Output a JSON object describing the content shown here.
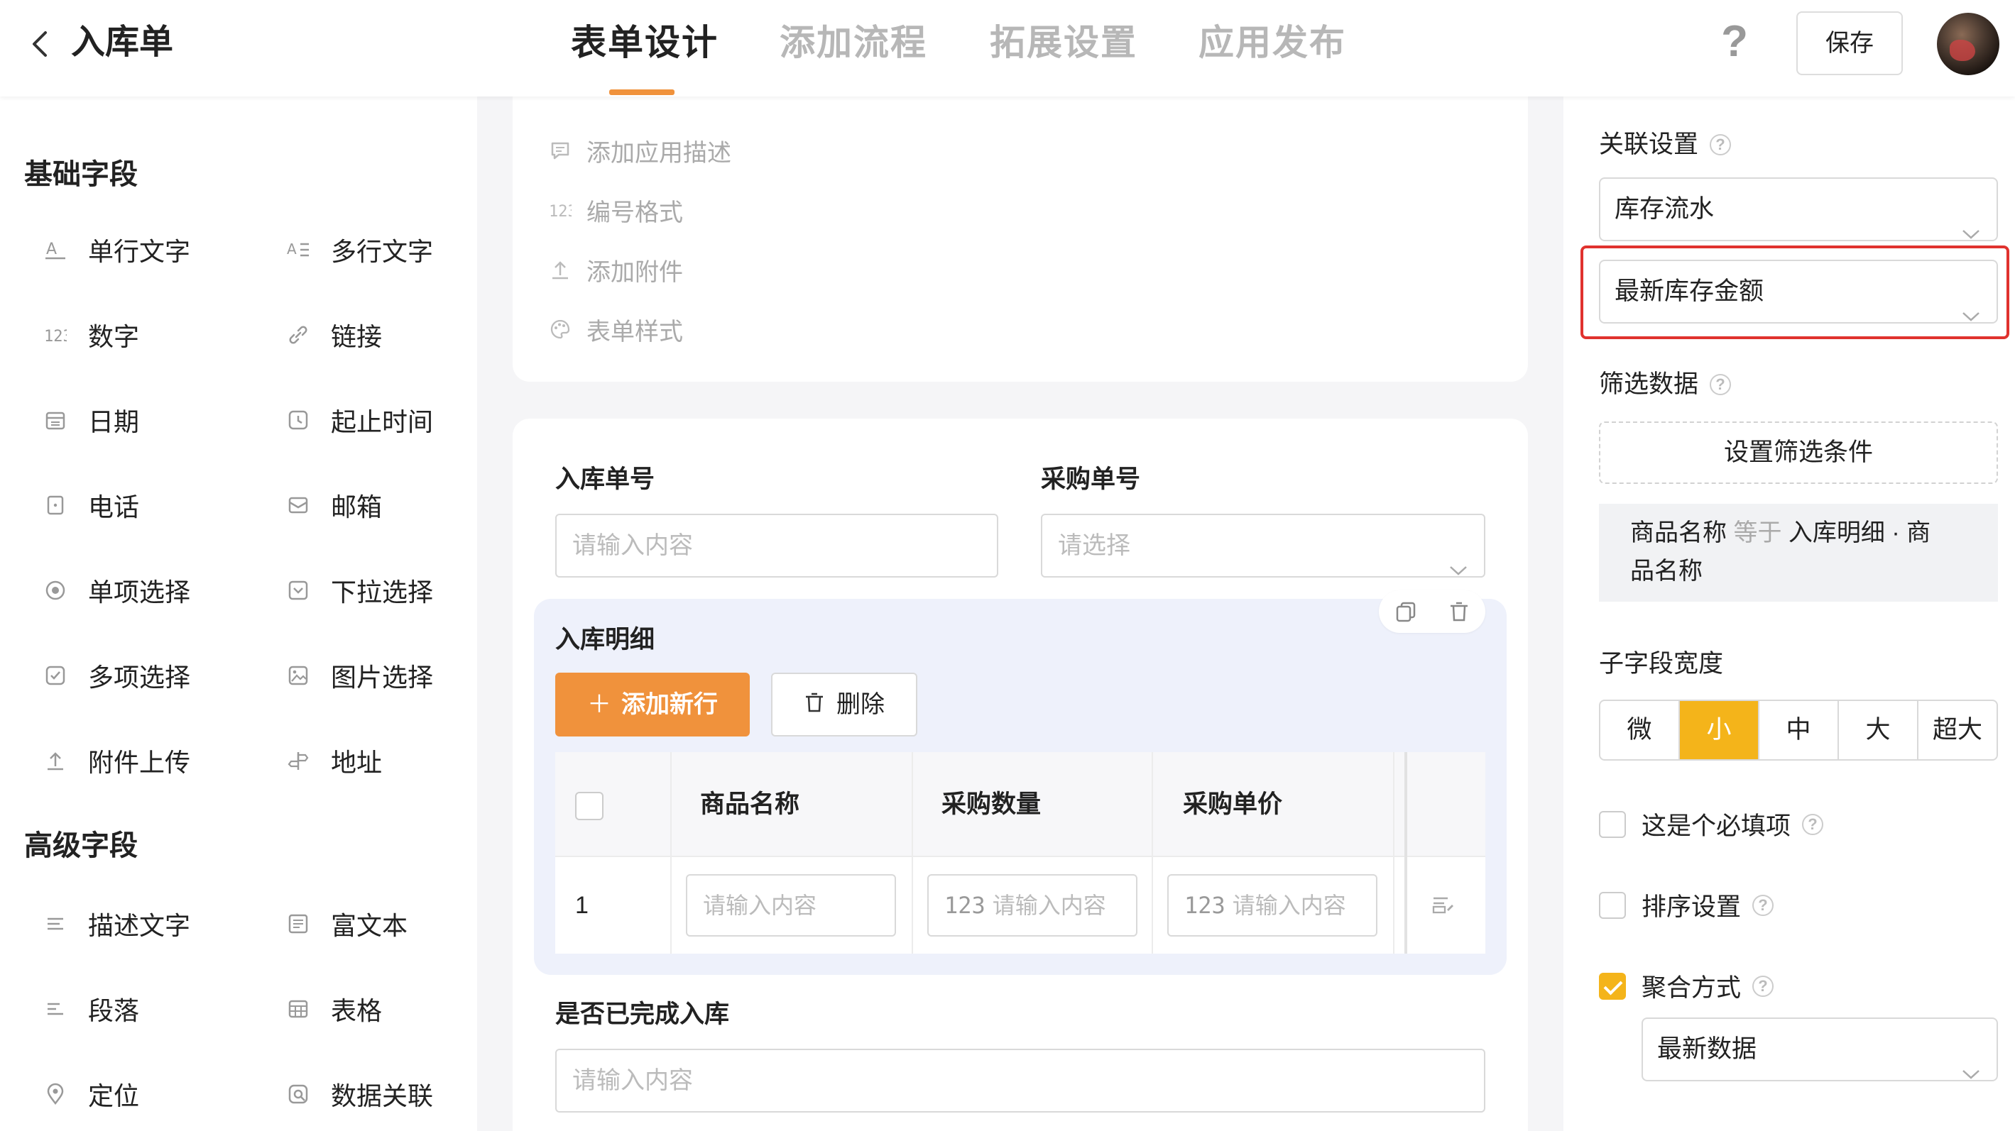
{
  "header": {
    "title": "入库单",
    "tabs": [
      "表单设计",
      "添加流程",
      "拓展设置",
      "应用发布"
    ],
    "active_tab": 0,
    "help": "?",
    "save_label": "保存"
  },
  "left": {
    "basic_title": "基础字段",
    "basic_fields": [
      "单行文字",
      "多行文字",
      "数字",
      "链接",
      "日期",
      "起止时间",
      "电话",
      "邮箱",
      "单项选择",
      "下拉选择",
      "多项选择",
      "图片选择",
      "附件上传",
      "地址"
    ],
    "advanced_title": "高级字段",
    "advanced_fields": [
      "描述文字",
      "富文本",
      "段落",
      "表格",
      "定位",
      "数据关联"
    ]
  },
  "form_menu": [
    "添加应用描述",
    "编号格式",
    "添加附件",
    "表单样式"
  ],
  "form": {
    "field1_label": "入库单号",
    "field1_placeholder": "请输入内容",
    "field2_label": "采购单号",
    "field2_placeholder": "请选择",
    "subtable_title": "入库明细",
    "add_row": "添加新行",
    "delete": "删除",
    "columns": [
      "商品名称",
      "采购数量",
      "采购单价"
    ],
    "row_index": "1",
    "cell_placeholder": "请输入内容",
    "field3_label": "是否已完成入库",
    "field3_placeholder": "请输入内容"
  },
  "right": {
    "link_label": "关联设置",
    "link_table": "库存流水",
    "link_field": "最新库存金额",
    "filter_label": "筛选数据",
    "filter_button": "设置筛选条件",
    "filter_field": "商品名称",
    "filter_op": "等于",
    "filter_value_1": "入库明细 · 商",
    "filter_value_2": "品名称",
    "width_label": "子字段宽度",
    "width_options": [
      "微",
      "小",
      "中",
      "大",
      "超大"
    ],
    "width_selected": 1,
    "required_label": "这是个必填项",
    "sort_label": "排序设置",
    "aggregate_label": "聚合方式",
    "aggregate_value": "最新数据",
    "accent_color": "#f4b41a",
    "brand_orange": "#f0923c",
    "highlight_color": "#e0322e"
  }
}
